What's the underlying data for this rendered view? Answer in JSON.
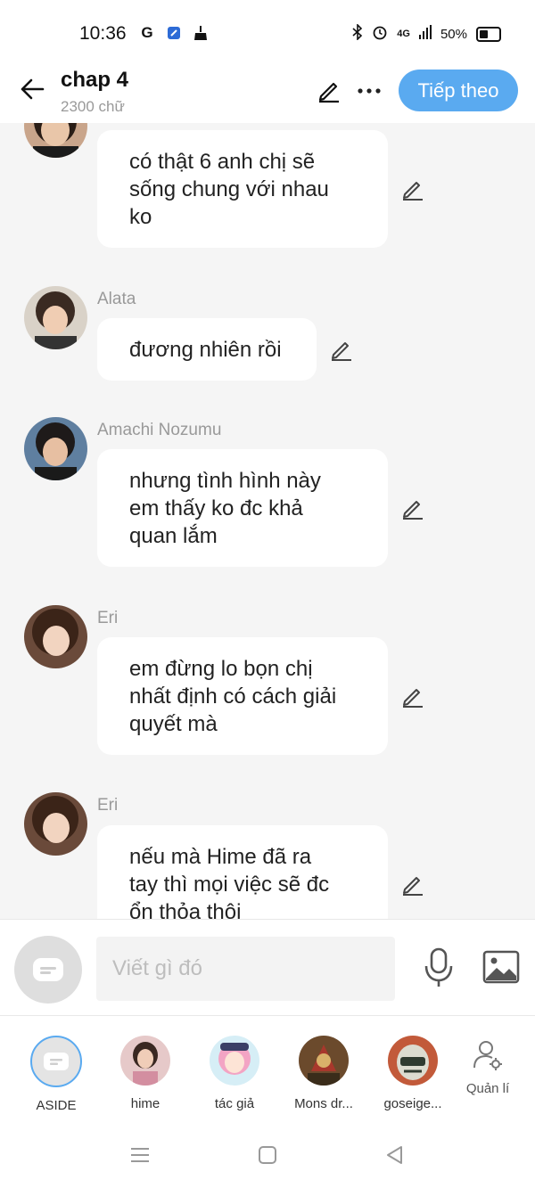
{
  "status_bar": {
    "time": "10:36",
    "network": "4G",
    "battery": "50%"
  },
  "header": {
    "title": "chap 4",
    "subtitle": "2300 chữ",
    "next_label": "Tiếp theo"
  },
  "messages": [
    {
      "sender": "",
      "text_lines": [
        "có thật 6 anh chị sẽ",
        "sống chung với nhau",
        "ko"
      ]
    },
    {
      "sender": "Alata",
      "text_lines": [
        "đương nhiên rồi"
      ]
    },
    {
      "sender": "Amachi Nozumu",
      "text_lines": [
        "nhưng tình hình này",
        "em thấy ko đc khả",
        "quan lắm"
      ]
    },
    {
      "sender": "Eri",
      "text_lines": [
        "em đừng lo bọn chị",
        "nhất định có cách giải",
        "quyết mà"
      ]
    },
    {
      "sender": "Eri",
      "text_lines": [
        "nếu mà Hime đã ra",
        "tay thì mọi việc sẽ đc",
        "ổn thỏa thôi"
      ]
    }
  ],
  "input": {
    "placeholder": "Viết gì đó"
  },
  "characters": [
    {
      "name": "ASIDE"
    },
    {
      "name": "hime"
    },
    {
      "name": "tác giả"
    },
    {
      "name": "Mons dr..."
    },
    {
      "name": "goseige..."
    }
  ],
  "manage_label": "Quản lí",
  "colors": {
    "accent": "#5aaaf0",
    "background": "#f5f5f5",
    "bubble": "#ffffff",
    "muted_text": "#999999"
  }
}
